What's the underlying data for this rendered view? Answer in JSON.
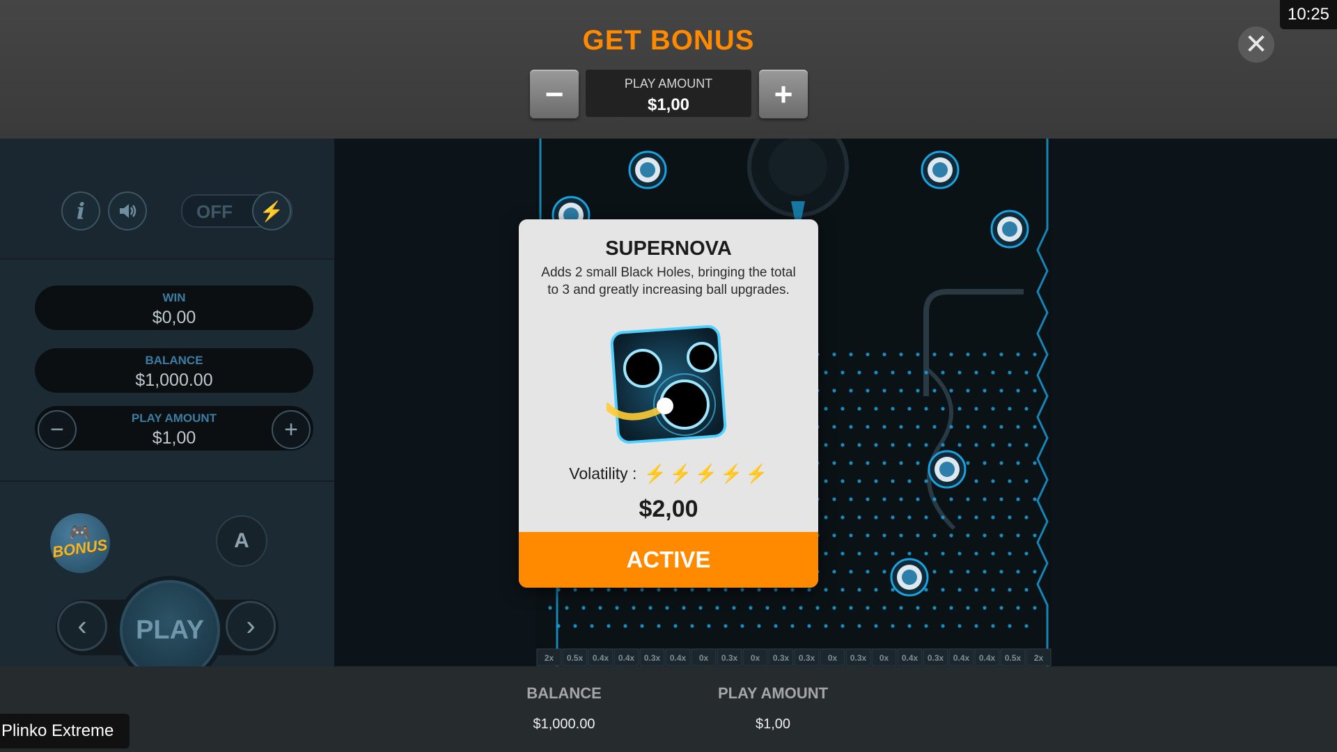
{
  "clock": "10:25",
  "bonus_header": {
    "title": "GET BONUS",
    "minus_label": "−",
    "plus_label": "+",
    "play_amount_label": "PLAY AMOUNT",
    "play_amount_value": "$1,00",
    "close_label": "✕"
  },
  "left_panel": {
    "info_label": "i",
    "turbo_state": "OFF",
    "win": {
      "label": "WIN",
      "value": "$0,00"
    },
    "balance": {
      "label": "BALANCE",
      "value": "$1,000.00"
    },
    "play_amount": {
      "label": "PLAY AMOUNT",
      "value": "$1,00",
      "minus": "−",
      "plus": "+"
    },
    "bonus_badge_text": "BONUS",
    "autoplay_label": "A",
    "play_label": "PLAY",
    "prev_label": "‹",
    "next_label": "›"
  },
  "board": {
    "multipliers": [
      "2x",
      "0.5x",
      "0.4x",
      "0.4x",
      "0.3x",
      "0.4x",
      "0x",
      "0.3x",
      "0x",
      "0.3x",
      "0.3x",
      "0x",
      "0.3x",
      "0x",
      "0.4x",
      "0.3x",
      "0.4x",
      "0.4x",
      "0.5x",
      "2x"
    ],
    "accent_color": "#1aa3e0"
  },
  "modal": {
    "title": "SUPERNOVA",
    "description": "Adds 2 small Black Holes, bringing the total to 3 and greatly increasing ball upgrades.",
    "volatility_label": "Volatility :",
    "volatility_level": 5,
    "volatility_max": 5,
    "price": "$2,00",
    "button_label": "ACTIVE",
    "button_color": "#ff8a00"
  },
  "bottom_bar": {
    "balance_label": "BALANCE",
    "balance_value": "$1,000.00",
    "play_amount_label": "PLAY AMOUNT",
    "play_amount_value": "$1,00"
  },
  "game_title": "Plinko Extreme"
}
